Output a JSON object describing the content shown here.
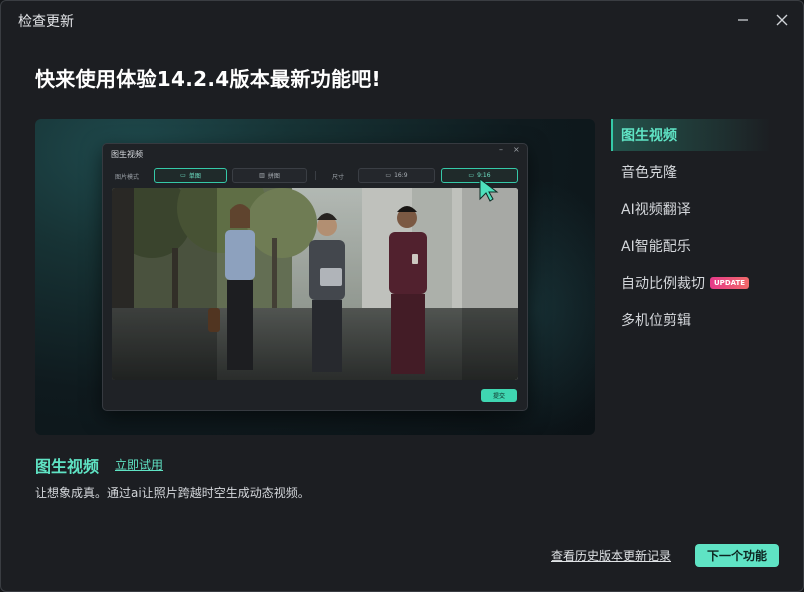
{
  "window": {
    "title": "检查更新",
    "minimize_icon": "minimize-icon",
    "close_icon": "close-icon"
  },
  "headline": "快来使用体验14.2.4版本最新功能吧!",
  "preview": {
    "mock_window": {
      "title": "图生视频",
      "minimize_glyph": "–",
      "close_glyph": "×",
      "mode_label": "图片模式",
      "mode_options": [
        {
          "label": "单图",
          "selected": true
        },
        {
          "label": "拼图",
          "selected": false
        }
      ],
      "size_label": "尺寸",
      "size_options": [
        {
          "label": "16:9",
          "selected": false
        },
        {
          "label": "9:16",
          "selected": true
        }
      ],
      "submit_label": "提交"
    },
    "cursor_icon": "pointer-cursor-icon"
  },
  "feature_list": {
    "items": [
      {
        "label": "图生视频",
        "active": true,
        "badge": ""
      },
      {
        "label": "音色克隆",
        "active": false,
        "badge": ""
      },
      {
        "label": "AI视频翻译",
        "active": false,
        "badge": ""
      },
      {
        "label": "AI智能配乐",
        "active": false,
        "badge": ""
      },
      {
        "label": "自动比例裁切",
        "active": false,
        "badge": "UPDATE"
      },
      {
        "label": "多机位剪辑",
        "active": false,
        "badge": ""
      }
    ]
  },
  "feature_detail": {
    "name": "图生视频",
    "try_link": "立即试用",
    "description": "让想象成真。通过ai让照片跨越时空生成动态视频。"
  },
  "footer": {
    "history_link": "查看历史版本更新记录",
    "next_button": "下一个功能"
  },
  "colors": {
    "accent": "#5fe3c4",
    "accent_border": "#35c9a8",
    "window_bg": "#1c1e22",
    "badge_start": "#e63a8a",
    "badge_end": "#f06a6a"
  }
}
